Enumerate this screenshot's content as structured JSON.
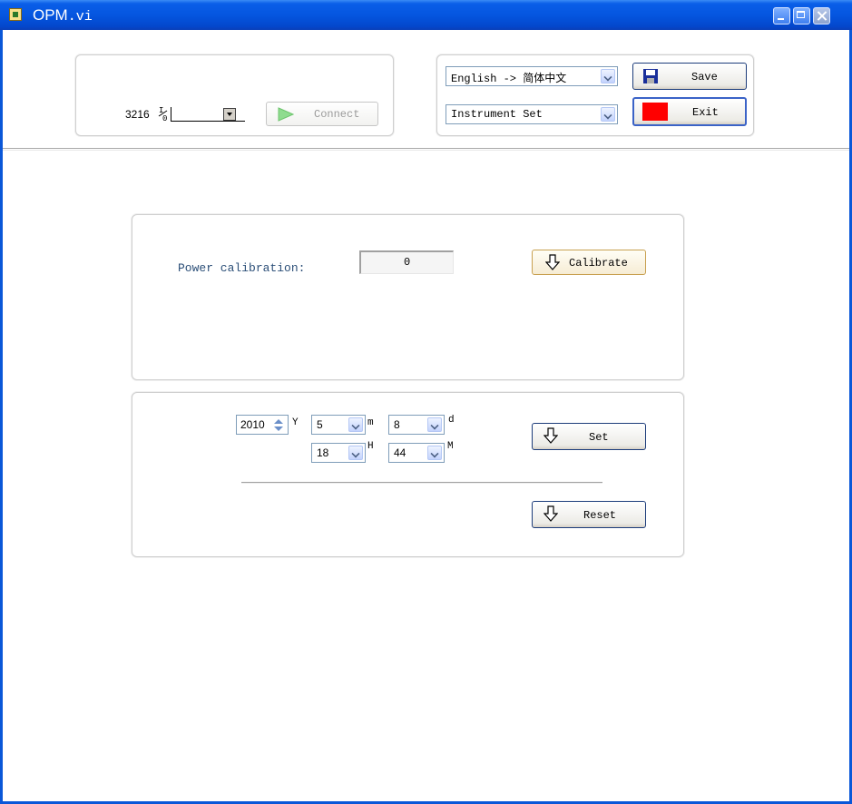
{
  "window": {
    "title_main": "OPM",
    "title_ext": ".vi"
  },
  "connection": {
    "port_value": "3216",
    "port_symbol": "I/O",
    "connect_label": "Connect"
  },
  "settings": {
    "language_select": "English -> 简体中文",
    "mode_select": "Instrument Set",
    "save_label": "Save",
    "exit_label": "Exit"
  },
  "calibration": {
    "label": "Power calibration:",
    "value": "0",
    "calibrate_label": "Calibrate"
  },
  "datetime": {
    "year": "2010",
    "year_unit": "Y",
    "month": "5",
    "month_unit": "m",
    "day": "8",
    "day_unit": "d",
    "hour": "18",
    "hour_unit": "H",
    "minute": "44",
    "minute_unit": "M",
    "set_label": "Set",
    "reset_label": "Reset"
  },
  "colors": {
    "titlebar": "#0556e0",
    "label_text": "#2c4f78",
    "exit_indicator": "#ff0000",
    "connect_arrow": "#7ed07e"
  },
  "icons": {
    "app": "labview-vi-icon",
    "save": "floppy-disk-icon",
    "exit": "red-square-icon",
    "connect": "play-arrow-icon",
    "calibrate": "down-arrow-icon"
  }
}
